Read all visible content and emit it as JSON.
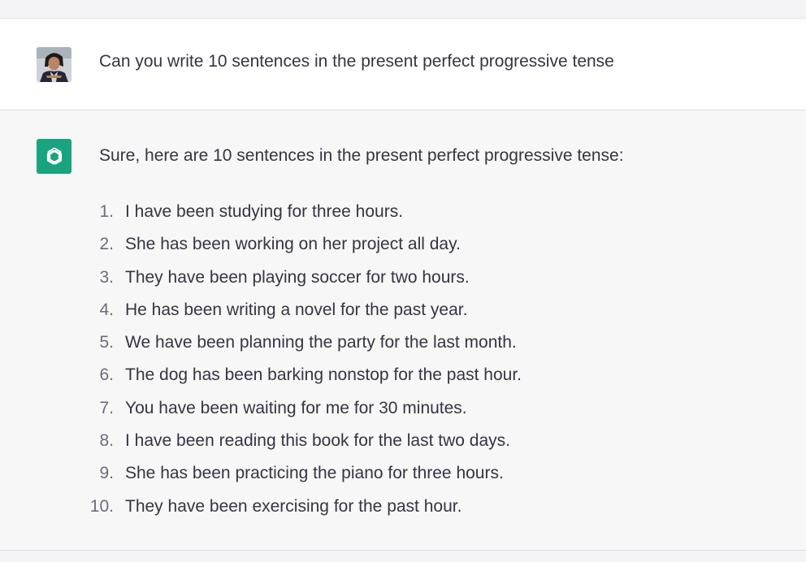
{
  "conversation": {
    "user_message": "Can you write 10 sentences in the present perfect progressive tense",
    "assistant_intro": "Sure, here are 10 sentences in the present perfect progressive tense:",
    "assistant_items": [
      {
        "num": "1.",
        "text": "I have been studying for three hours."
      },
      {
        "num": "2.",
        "text": "She has been working on her project all day."
      },
      {
        "num": "3.",
        "text": "They have been playing soccer for two hours."
      },
      {
        "num": "4.",
        "text": "He has been writing a novel for the past year."
      },
      {
        "num": "5.",
        "text": "We have been planning the party for the last month."
      },
      {
        "num": "6.",
        "text": "The dog has been barking nonstop for the past hour."
      },
      {
        "num": "7.",
        "text": "You have been waiting for me for 30 minutes."
      },
      {
        "num": "8.",
        "text": "I have been reading this book for the last two days."
      },
      {
        "num": "9.",
        "text": "She has been practicing the piano for three hours."
      },
      {
        "num": "10.",
        "text": "They have been exercising for the past hour."
      }
    ]
  },
  "icons": {
    "user_avatar": "user-avatar-photo",
    "assistant_logo": "openai-logo-icon"
  },
  "colors": {
    "assistant_icon_bg": "#19a37f",
    "user_row_bg": "#ffffff",
    "assistant_row_bg": "#f7f7f8",
    "text": "#343541",
    "list_number": "#6b6c7b"
  }
}
